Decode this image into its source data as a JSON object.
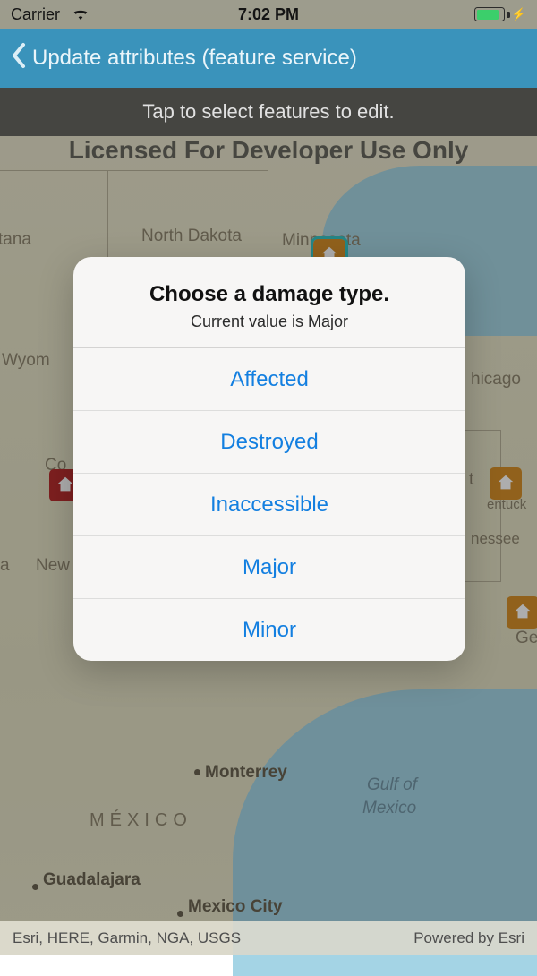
{
  "statusbar": {
    "carrier": "Carrier",
    "time": "7:02 PM"
  },
  "navbar": {
    "title": "Update attributes (feature service)"
  },
  "banner": {
    "text": "Tap to select features to edit."
  },
  "watermark": {
    "text": "Licensed For Developer Use Only"
  },
  "map": {
    "states": {
      "montana": "tana",
      "wyoming": "Wyom",
      "north_dakota": "North Dakota",
      "minnesota": "Minnesota",
      "a": "a",
      "new": "New",
      "col_fragment": "Co",
      "chicago": "hicago",
      "t_fragment": "t",
      "kentucky_fragment": "entuck",
      "tennessee_fragment": "nessee",
      "georgia_fragment": "Ge"
    },
    "region": "MÉXICO",
    "gulf": {
      "l1": "Gulf of",
      "l2": "Mexico"
    },
    "cities": {
      "monterrey": "Monterrey",
      "guadalajara": "Guadalajara",
      "mexico_city": "Mexico City"
    },
    "credits": {
      "left": "Esri, HERE, Garmin, NGA, USGS",
      "right": "Powered by Esri"
    }
  },
  "alert": {
    "title": "Choose a damage type.",
    "subtitle": "Current value is Major",
    "options": {
      "o0": "Affected",
      "o1": "Destroyed",
      "o2": "Inaccessible",
      "o3": "Major",
      "o4": "Minor"
    }
  }
}
